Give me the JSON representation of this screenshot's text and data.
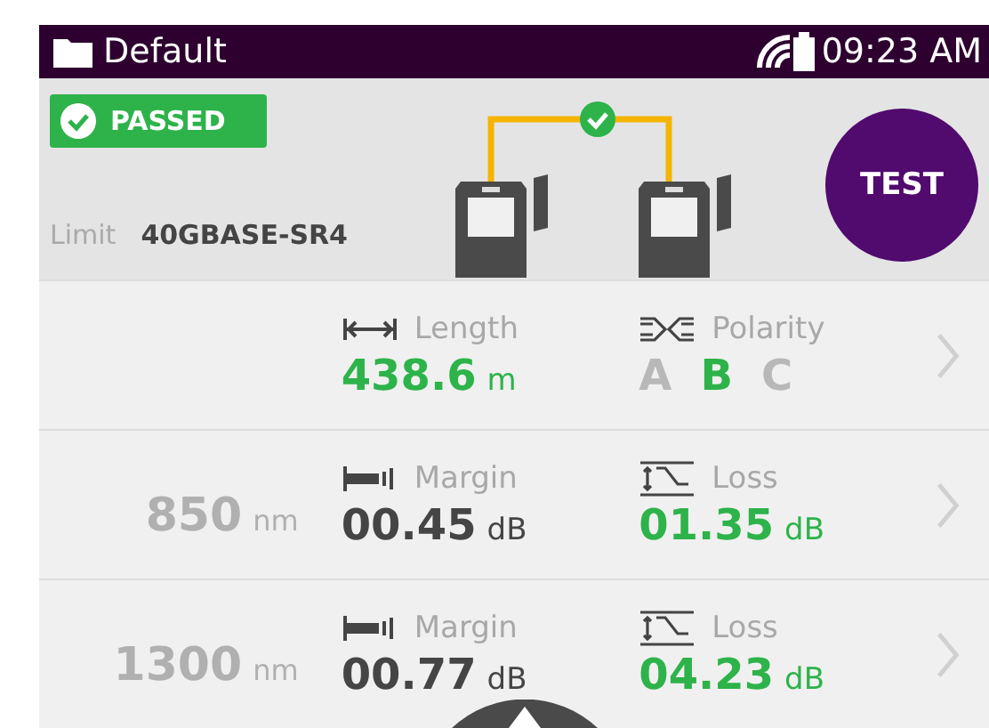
{
  "header": {
    "title": "Default",
    "time": "09:23 AM"
  },
  "summary": {
    "status": "PASSED",
    "passed": true,
    "limit_label": "Limit",
    "limit_value": "40GBASE-SR4",
    "test_button": "TEST"
  },
  "rows": [
    {
      "metrics": [
        {
          "kind": "length",
          "label": "Length",
          "value": "438.6",
          "unit": "m",
          "highlighted": true
        },
        {
          "kind": "polarity",
          "label": "Polarity",
          "letters": [
            {
              "label": "A",
              "selected": false
            },
            {
              "label": "B",
              "selected": true
            },
            {
              "label": "C",
              "selected": false
            }
          ]
        }
      ]
    },
    {
      "wavelength": "850",
      "wavelength_unit": "nm",
      "metrics": [
        {
          "kind": "margin",
          "label": "Margin",
          "value": "00.45",
          "unit": "dB",
          "highlighted": false
        },
        {
          "kind": "loss",
          "label": "Loss",
          "value": "01.35",
          "unit": "dB",
          "highlighted": true
        }
      ]
    },
    {
      "wavelength": "1300",
      "wavelength_unit": "nm",
      "metrics": [
        {
          "kind": "margin",
          "label": "Margin",
          "value": "00.77",
          "unit": "dB",
          "highlighted": false
        },
        {
          "kind": "loss",
          "label": "Loss",
          "value": "04.23",
          "unit": "dB",
          "highlighted": true
        }
      ]
    }
  ]
}
